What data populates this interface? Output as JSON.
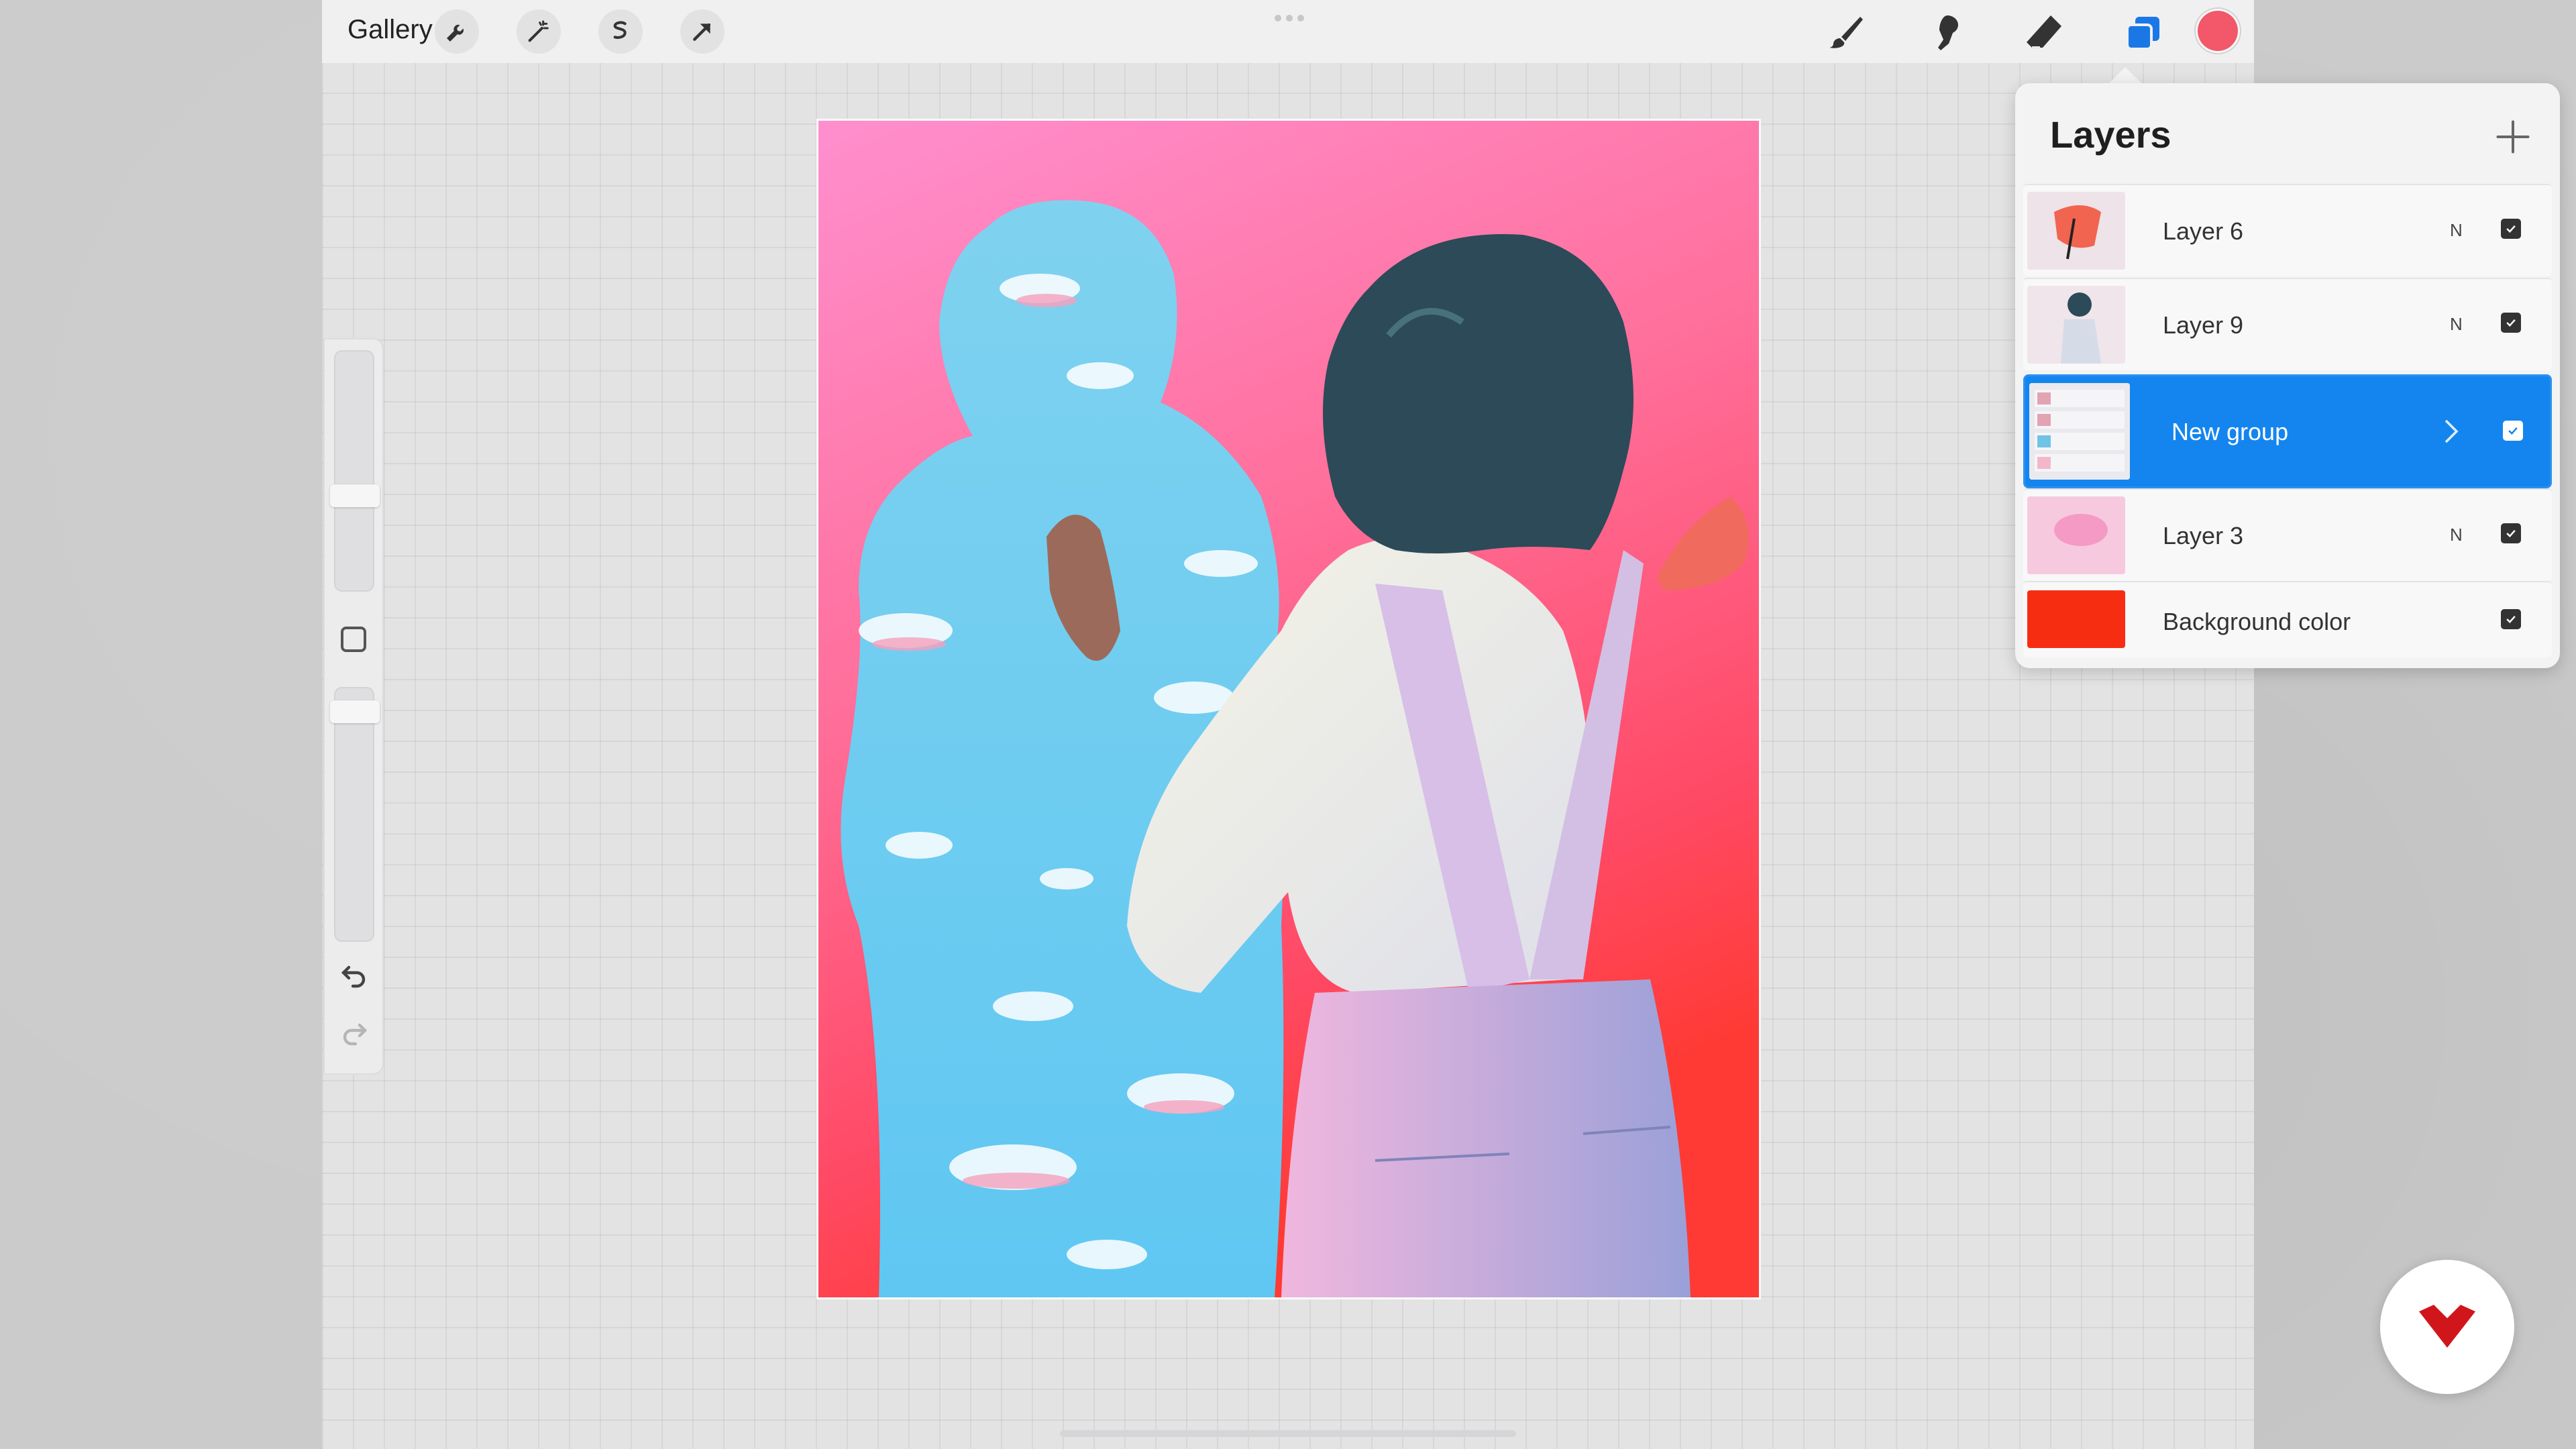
{
  "topbar": {
    "gallery_label": "Gallery",
    "left_tools": [
      "wrench-icon",
      "magic-wand-icon",
      "selection-icon",
      "transform-arrow-icon"
    ],
    "right_tools": [
      "brush-icon",
      "smudge-icon",
      "eraser-icon",
      "layers-icon"
    ],
    "current_color": "#f2576a",
    "layers_accent": "#1a78e6"
  },
  "sidebar": {
    "tools": [
      "brush-size-slider",
      "modify-button",
      "opacity-slider",
      "undo-icon",
      "redo-icon"
    ]
  },
  "layers_panel": {
    "title": "Layers",
    "add_icon": "plus-icon",
    "rows": [
      {
        "name": "Layer 6",
        "blend": "N",
        "visible": true
      },
      {
        "name": "Layer 9",
        "blend": "N",
        "visible": true
      },
      {
        "name": "New group",
        "blend": "",
        "visible": true,
        "selected": true
      },
      {
        "name": "Layer 3",
        "blend": "N",
        "visible": true
      },
      {
        "name": "Background color",
        "blend": "",
        "visible": true,
        "swatch": "#f72d12"
      }
    ]
  },
  "brand": {
    "accent": "#d0161b"
  }
}
